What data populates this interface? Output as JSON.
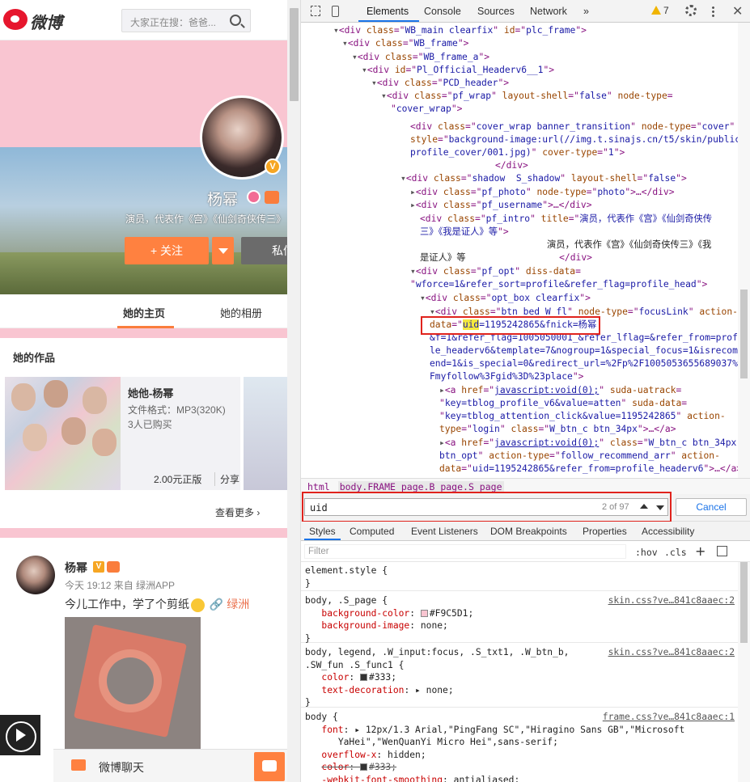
{
  "weibo": {
    "logo_text": "微博",
    "search_placeholder": "大家正在搜：爸爸...",
    "profile": {
      "name": "杨幂",
      "verified_badge": "V",
      "intro": "演员，代表作《宫》《仙剑奇侠传三》",
      "follow_label": "+ 关注",
      "message_label": "私信"
    },
    "tabs": [
      "她的主页",
      "她的相册"
    ],
    "works": {
      "title": "她的作品",
      "album_name": "她他-杨幂",
      "album_format": "文件格式：MP3(320K)",
      "album_buyers": "3人已购买",
      "album_price": "2.00元正版",
      "album_share": "分享",
      "see_more": "查看更多 ›"
    },
    "feed": {
      "name": "杨幂",
      "verified": "V",
      "time": "今天 19:12 来自 绿洲APP",
      "text": "今儿工作中，学了个剪纸",
      "link": "🔗 绿洲"
    },
    "chat_label": "微博聊天"
  },
  "devtools": {
    "tabs": [
      "Elements",
      "Console",
      "Sources",
      "Network",
      "»"
    ],
    "warning_count": "7",
    "breadcrumb": [
      "html",
      "body.FRAME_page.B_page.S_page"
    ],
    "find": {
      "query": "uid",
      "count": "2 of 97",
      "cancel_label": "Cancel"
    },
    "styles_tabs": [
      "Styles",
      "Computed",
      "Event Listeners",
      "DOM Breakpoints",
      "Properties",
      "Accessibility"
    ],
    "filter_placeholder": "Filter",
    "hov_label": ":hov",
    "cls_label": ".cls",
    "colors": {
      "accent": "#1a73e8",
      "highlight_box": "#e0231d",
      "page_bg": "#F9C5D1"
    }
  }
}
